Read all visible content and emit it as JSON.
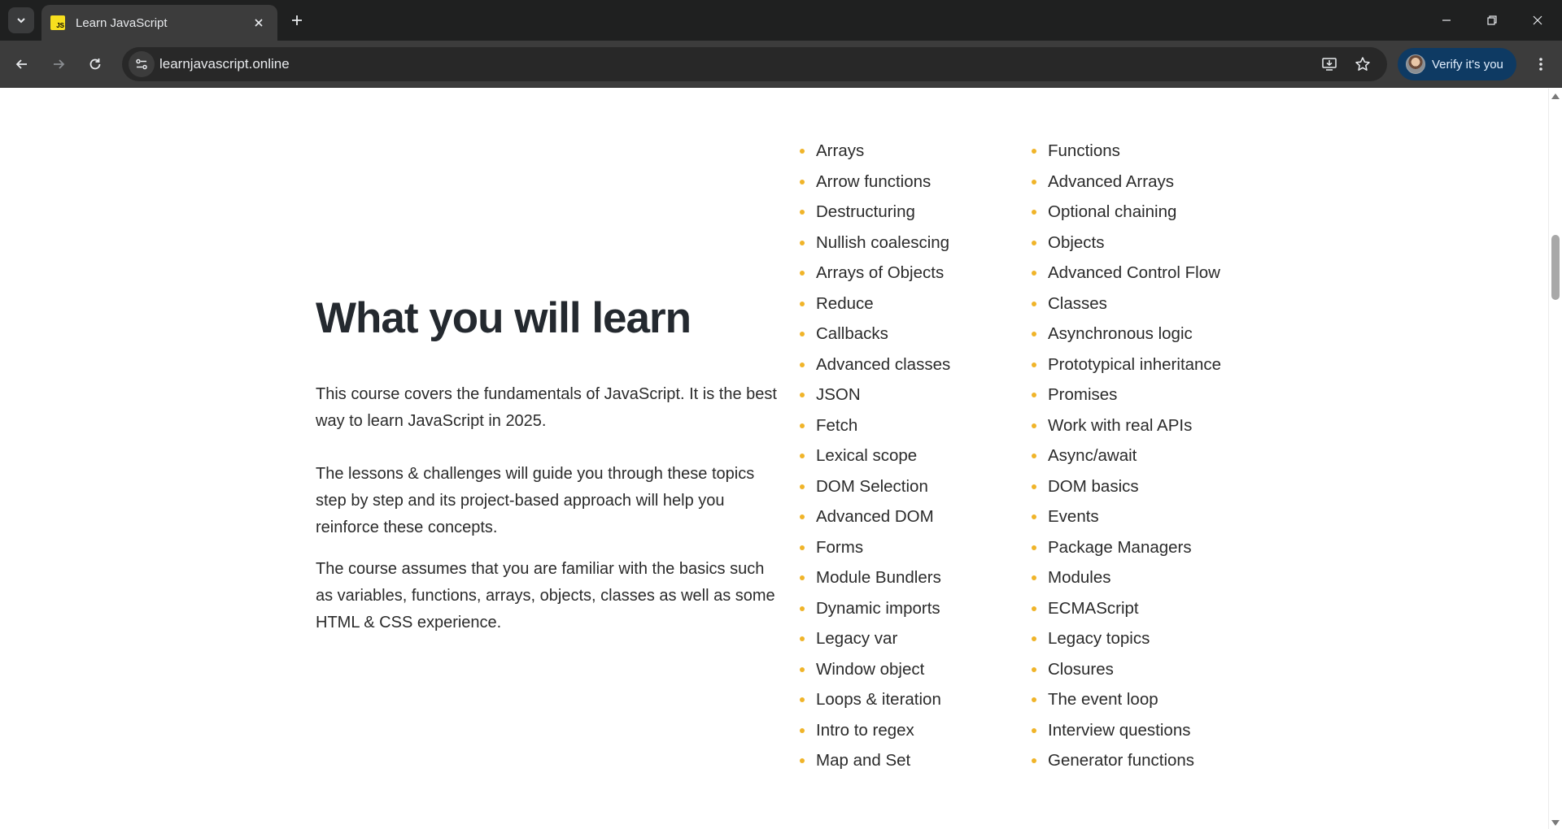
{
  "browser": {
    "tab_title": "Learn JavaScript",
    "favicon_text": "JS",
    "url": "learnjavascript.online",
    "profile_label": "Verify it's you",
    "icons": [
      "tab-search-icon",
      "close-icon",
      "plus-icon",
      "minimize-icon",
      "restore-icon",
      "close-window-icon",
      "back-icon",
      "forward-icon",
      "reload-icon",
      "site-info-icon",
      "install-app-icon",
      "star-icon",
      "more-menu-icon"
    ]
  },
  "page": {
    "heading": "What you will learn",
    "paragraphs": [
      "This course covers the fundamentals of JavaScript. It is the best way to learn JavaScript in 2025.",
      "The lessons & challenges will guide you through these topics step by step and its project-based approach will help you reinforce these concepts.",
      "The course assumes that you are familiar with the basics such as variables, functions, arrays, objects, classes as well as some HTML & CSS experience."
    ],
    "topics_col1": [
      "Arrays",
      "Arrow functions",
      "Destructuring",
      "Nullish coalescing",
      "Arrays of Objects",
      "Reduce",
      "Callbacks",
      "Advanced classes",
      "JSON",
      "Fetch",
      "Lexical scope",
      "DOM Selection",
      "Advanced DOM",
      "Forms",
      "Module Bundlers",
      "Dynamic imports",
      "Legacy var",
      "Window object",
      "Loops & iteration",
      "Intro to regex",
      "Map and Set"
    ],
    "topics_col2": [
      "Functions",
      "Advanced Arrays",
      "Optional chaining",
      "Objects",
      "Advanced Control Flow",
      "Classes",
      "Asynchronous logic",
      "Prototypical inheritance",
      "Promises",
      "Work with real APIs",
      "Async/await",
      "DOM basics",
      "Events",
      "Package Managers",
      "Modules",
      "ECMAScript",
      "Legacy topics",
      "Closures",
      "The event loop",
      "Interview questions",
      "Generator functions"
    ]
  },
  "colors": {
    "bullet": "#f0b429",
    "heading": "#24292f",
    "chrome_dark": "#1f2020",
    "chrome_toolbar": "#3c3c3c",
    "profile_pill": "#0e3a63"
  }
}
